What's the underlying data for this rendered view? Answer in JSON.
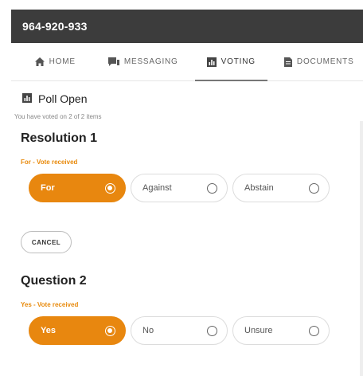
{
  "header": {
    "title": "964-920-933"
  },
  "tabs": [
    {
      "label": "HOME",
      "icon": "home-icon"
    },
    {
      "label": "MESSAGING",
      "icon": "messaging-icon"
    },
    {
      "label": "VOTING",
      "icon": "voting-icon",
      "active": true
    },
    {
      "label": "DOCUMENTS",
      "icon": "document-icon"
    }
  ],
  "poll": {
    "status": "Poll Open",
    "voted_note": "You have voted on 2 of 2 items"
  },
  "items": [
    {
      "title": "Resolution 1",
      "vote_status": "For - Vote received",
      "options": [
        {
          "label": "For",
          "selected": true
        },
        {
          "label": "Against",
          "selected": false
        },
        {
          "label": "Abstain",
          "selected": false
        }
      ],
      "cancel_label": "CANCEL"
    },
    {
      "title": "Question 2",
      "vote_status": "Yes - Vote received",
      "options": [
        {
          "label": "Yes",
          "selected": true
        },
        {
          "label": "No",
          "selected": false
        },
        {
          "label": "Unsure",
          "selected": false
        }
      ]
    }
  ],
  "colors": {
    "accent": "#e8870f",
    "header_bg": "#3c3c3c"
  }
}
